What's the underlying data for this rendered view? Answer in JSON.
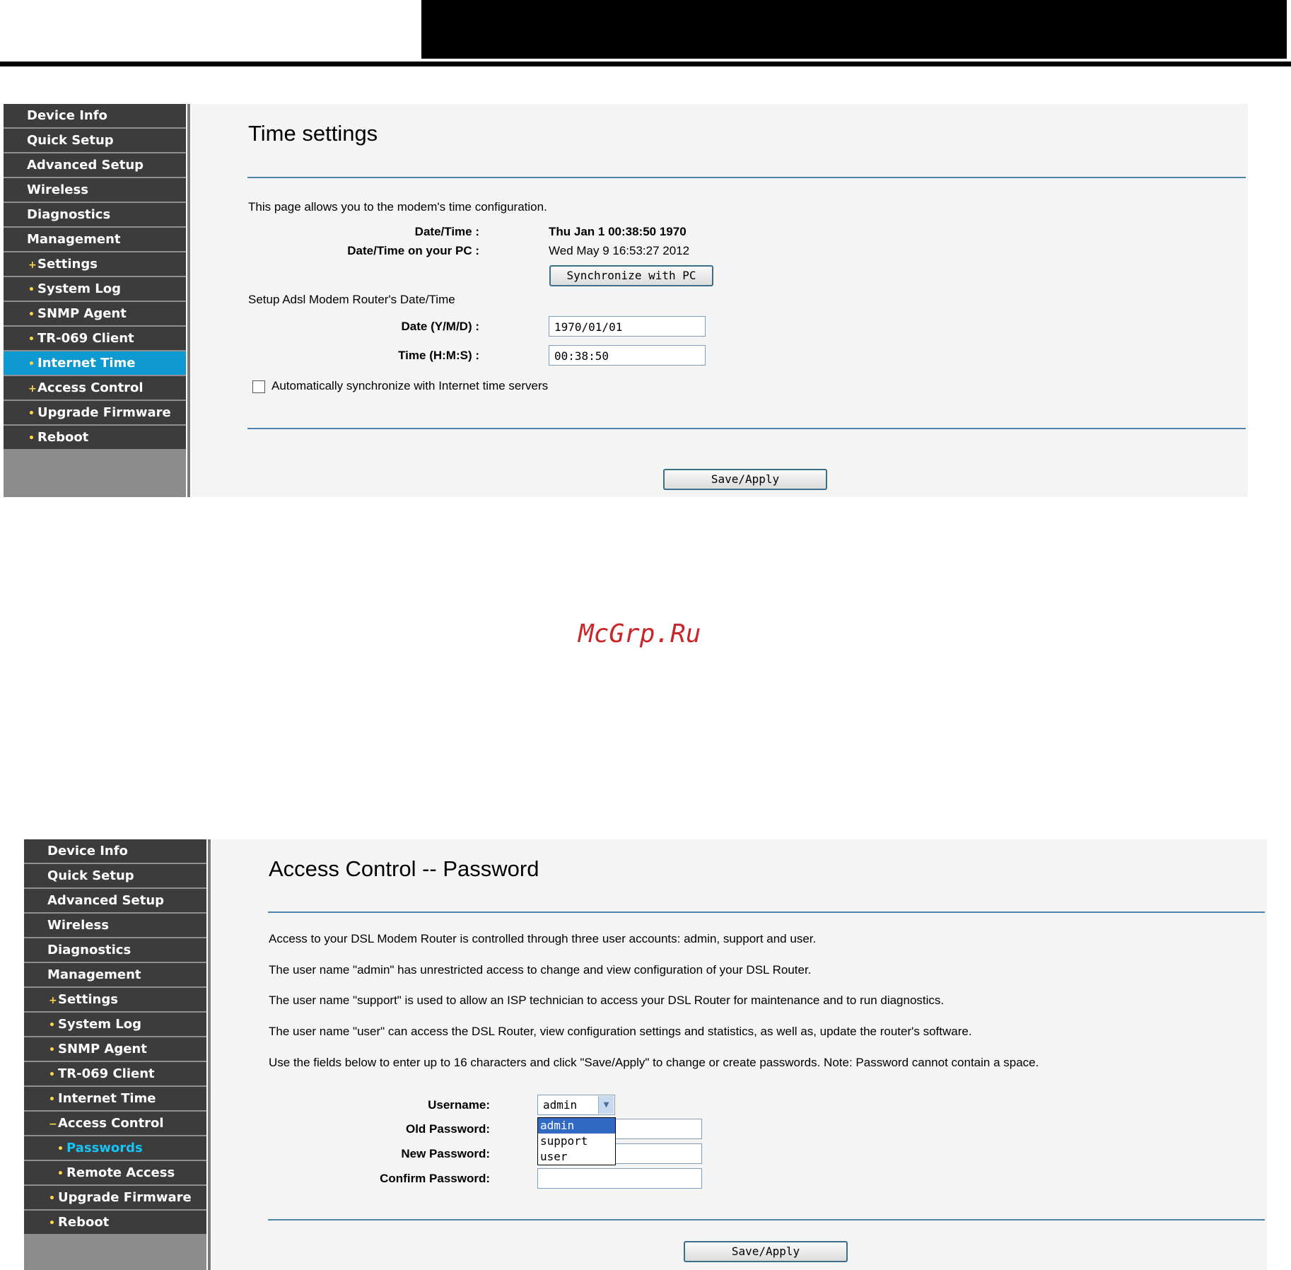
{
  "top_panel": {
    "nav": [
      {
        "label": "Device Info",
        "level": 0
      },
      {
        "label": "Quick Setup",
        "level": 0
      },
      {
        "label": "Advanced Setup",
        "level": 0
      },
      {
        "label": "Wireless",
        "level": 0
      },
      {
        "label": "Diagnostics",
        "level": 0
      },
      {
        "label": "Management",
        "level": 0
      },
      {
        "label": "Settings",
        "level": 1,
        "bullet": "+"
      },
      {
        "label": "System Log",
        "level": 1,
        "bullet": "•"
      },
      {
        "label": "SNMP Agent",
        "level": 1,
        "bullet": "•"
      },
      {
        "label": "TR-069 Client",
        "level": 1,
        "bullet": "•"
      },
      {
        "label": "Internet Time",
        "level": 1,
        "bullet": "•",
        "active": true
      },
      {
        "label": "Access Control",
        "level": 1,
        "bullet": "+"
      },
      {
        "label": "Upgrade Firmware",
        "level": 1,
        "bullet": "•"
      },
      {
        "label": "Reboot",
        "level": 1,
        "bullet": "•"
      }
    ],
    "title": "Time settings",
    "intro": "This page allows you to the modem's time configuration.",
    "datetime_label": "Date/Time :",
    "datetime_value": "Thu Jan 1 00:38:50 1970",
    "pc_label": "Date/Time on your PC :",
    "pc_value": "Wed May 9 16:53:27 2012",
    "sync_button": "Synchronize with PC",
    "setup_heading": "Setup Adsl Modem Router's Date/Time",
    "date_label": "Date (Y/M/D) :",
    "date_value": "1970/01/01",
    "time_label": "Time (H:M:S) :",
    "time_value": "00:38:50",
    "auto_sync_label": "Automatically synchronize with Internet time servers",
    "auto_sync_checked": false,
    "save_button": "Save/Apply"
  },
  "watermark": "McGrp.Ru",
  "bottom_panel": {
    "nav": [
      {
        "label": "Device Info",
        "level": 0
      },
      {
        "label": "Quick Setup",
        "level": 0
      },
      {
        "label": "Advanced Setup",
        "level": 0
      },
      {
        "label": "Wireless",
        "level": 0
      },
      {
        "label": "Diagnostics",
        "level": 0
      },
      {
        "label": "Management",
        "level": 0
      },
      {
        "label": "Settings",
        "level": 1,
        "bullet": "+"
      },
      {
        "label": "System Log",
        "level": 1,
        "bullet": "•"
      },
      {
        "label": "SNMP Agent",
        "level": 1,
        "bullet": "•"
      },
      {
        "label": "TR-069 Client",
        "level": 1,
        "bullet": "•"
      },
      {
        "label": "Internet Time",
        "level": 1,
        "bullet": "•"
      },
      {
        "label": "Access Control",
        "level": 1,
        "bullet": "−"
      },
      {
        "label": "Passwords",
        "level": 2,
        "bullet": "•",
        "current": true
      },
      {
        "label": "Remote Access",
        "level": 2,
        "bullet": "•"
      },
      {
        "label": "Upgrade Firmware",
        "level": 1,
        "bullet": "•"
      },
      {
        "label": "Reboot",
        "level": 1,
        "bullet": "•"
      }
    ],
    "title": "Access Control -- Password",
    "paragraphs": [
      "Access to your DSL Modem Router is controlled through three user accounts: admin, support and user.",
      "The user name \"admin\" has unrestricted access to change and view configuration of your DSL Router.",
      "The user name \"support\" is used to allow an ISP technician to access your DSL Router for maintenance and to run diagnostics.",
      "The user name \"user\" can access the DSL Router, view configuration settings and statistics, as well as, update the router's software.",
      "Use the fields below to enter up to 16 characters and click \"Save/Apply\" to change or create passwords. Note: Password cannot contain a space."
    ],
    "username_label": "Username:",
    "username_value": "admin",
    "username_options": [
      "admin",
      "support",
      "user"
    ],
    "old_password_label": "Old Password:",
    "new_password_label": "New Password:",
    "confirm_password_label": "Confirm Password:",
    "save_button": "Save/Apply"
  },
  "colors": {
    "nav_bg": "#3c3c3c",
    "nav_active": "#0e9ad0",
    "rule_blue": "#4c85a8",
    "watermark": "#c8262a"
  }
}
